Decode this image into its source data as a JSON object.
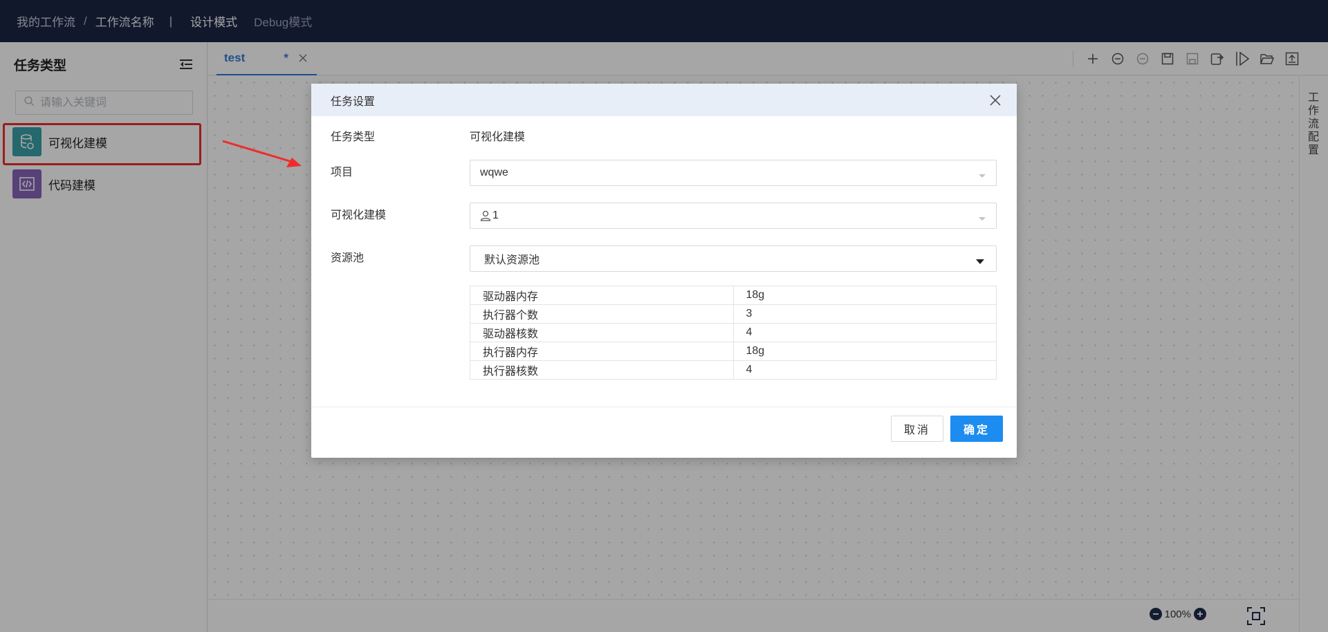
{
  "topbar": {
    "breadcrumb_root": "我的工作流",
    "breadcrumb_sep": "/",
    "breadcrumb_current": "工作流名称",
    "bar": "|",
    "mode_design": "设计模式",
    "mode_debug": "Debug模式"
  },
  "sidebar": {
    "title": "任务类型",
    "search_placeholder": "请输入关键词",
    "items": [
      {
        "label": "可视化建模",
        "icon": "database-icon",
        "color": "#3aa0a8"
      },
      {
        "label": "代码建模",
        "icon": "code-icon",
        "color": "#8763b8"
      }
    ]
  },
  "tabs": [
    {
      "label": "test",
      "modified": "*"
    }
  ],
  "toolbar_icons": [
    "add-icon",
    "zoom-out-icon",
    "zoom-in-icon",
    "save-icon",
    "save-as-icon",
    "export-icon",
    "run-icon",
    "open-folder-icon",
    "upload-icon"
  ],
  "rightrail": {
    "label": "工作流配置"
  },
  "zoom": {
    "level": "100%"
  },
  "modal": {
    "title": "任务设置",
    "fields": {
      "task_type_label": "任务类型",
      "task_type_value": "可视化建模",
      "project_label": "项目",
      "project_value": "wqwe",
      "model_label": "可视化建模",
      "model_value": "1",
      "pool_label": "资源池",
      "pool_value": "默认资源池"
    },
    "resources": [
      {
        "name": "驱动器内存",
        "value": "18g"
      },
      {
        "name": "执行器个数",
        "value": "3"
      },
      {
        "name": "驱动器核数",
        "value": "4"
      },
      {
        "name": "执行器内存",
        "value": "18g"
      },
      {
        "name": "执行器核数",
        "value": "4"
      }
    ],
    "cancel_label": "取消",
    "ok_label": "确定"
  },
  "colors": {
    "topbar_bg": "#1b2544",
    "accent": "#1c8cf0",
    "highlight": "#ef2c2c"
  }
}
